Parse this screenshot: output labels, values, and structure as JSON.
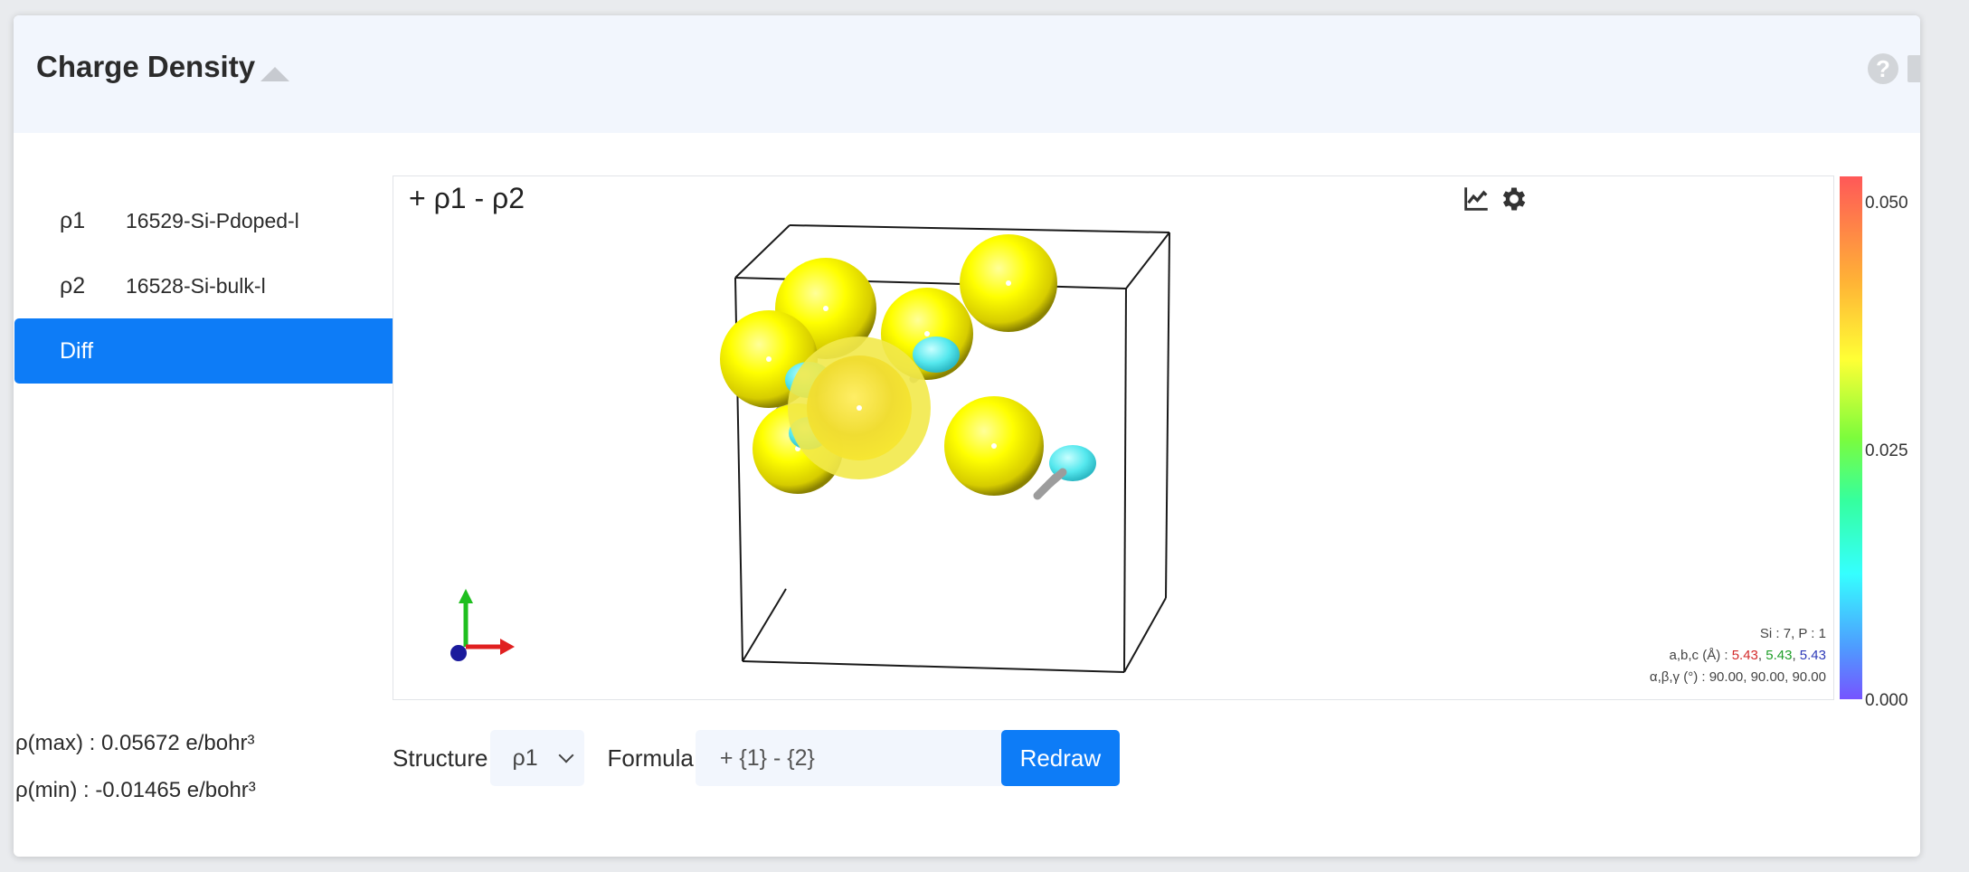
{
  "header": {
    "title": "Charge Density"
  },
  "list": [
    {
      "symbol": "ρ1",
      "name": "16529-Si-Pdoped-l"
    },
    {
      "symbol": "ρ2",
      "name": "16528-Si-bulk-l"
    },
    {
      "symbol": "",
      "name": "Diff"
    }
  ],
  "stats": {
    "max": "ρ(max) : 0.05672 e/bohr³",
    "min": "ρ(min) : -0.01465 e/bohr³"
  },
  "viewer": {
    "title": "+ ρ1 - ρ2",
    "info_composition": "Si : 7, P : 1",
    "info_abc_label": "a,b,c (Å) : ",
    "info_a": "5.43",
    "info_b": "5.43",
    "info_c": "5.43",
    "info_angles": "α,β,γ (°) : 90.00, 90.00, 90.00"
  },
  "colorbar": {
    "max": "0.050",
    "mid": "0.025",
    "min": "0.000"
  },
  "controls": {
    "structure_label": "Structure",
    "structure_value": "ρ1",
    "formula_label": "Formula",
    "formula_value": "+ {1} - {2}",
    "redraw_label": "Redraw"
  },
  "icons": [
    "caret-up-icon",
    "help-icon",
    "note-icon",
    "chart-icon",
    "gear-icon",
    "axes-icon"
  ],
  "colors": {
    "accent": "#0d7cf7",
    "header_bg": "#f2f6fd",
    "atom_si": "#ffff00",
    "density_cyan": "#55e8ee"
  }
}
